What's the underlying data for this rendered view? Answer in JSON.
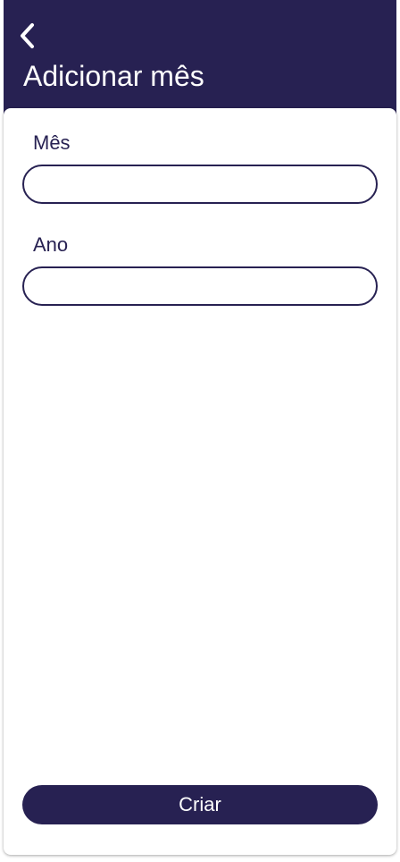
{
  "header": {
    "back_icon": "chevron-left-icon",
    "title": "Adicionar mês",
    "background_color": "#272152"
  },
  "form": {
    "month": {
      "label": "Mês",
      "value": "",
      "placeholder": ""
    },
    "year": {
      "label": "Ano",
      "value": "",
      "placeholder": ""
    }
  },
  "actions": {
    "create_label": "Criar"
  },
  "colors": {
    "primary": "#272152",
    "text_on_primary": "#ffffff"
  }
}
